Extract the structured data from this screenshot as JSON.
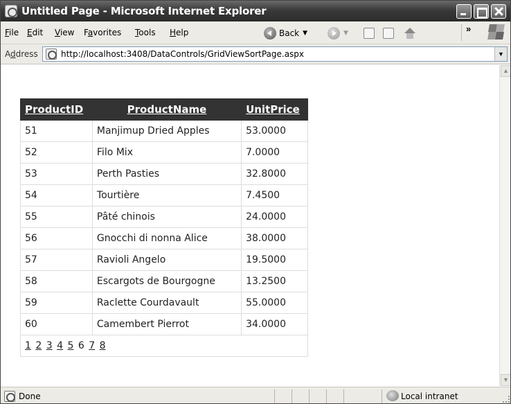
{
  "window": {
    "title": "Untitled Page - Microsoft Internet Explorer"
  },
  "menu": {
    "items": [
      {
        "label": "File",
        "accel": "F",
        "rest": "ile"
      },
      {
        "label": "Edit",
        "accel": "E",
        "rest": "dit"
      },
      {
        "label": "View",
        "accel": "V",
        "rest": "iew"
      },
      {
        "label": "Favorites",
        "pre": "F",
        "accel": "a",
        "rest": "vorites"
      },
      {
        "label": "Tools",
        "accel": "T",
        "rest": "ools"
      },
      {
        "label": "Help",
        "accel": "H",
        "rest": "elp"
      }
    ]
  },
  "toolbar": {
    "back_label": "Back",
    "overflow": "»"
  },
  "address": {
    "label_pre": "A",
    "label_accel": "d",
    "label_rest": "dress",
    "url": "http://localhost:3408/DataControls/GridViewSortPage.aspx"
  },
  "grid": {
    "headers": [
      "ProductID",
      "ProductName",
      "UnitPrice"
    ],
    "rows": [
      [
        "51",
        "Manjimup Dried Apples",
        "53.0000"
      ],
      [
        "52",
        "Filo Mix",
        "7.0000"
      ],
      [
        "53",
        "Perth Pasties",
        "32.8000"
      ],
      [
        "54",
        "Tourtière",
        "7.4500"
      ],
      [
        "55",
        "Pâté chinois",
        "24.0000"
      ],
      [
        "56",
        "Gnocchi di nonna Alice",
        "38.0000"
      ],
      [
        "57",
        "Ravioli Angelo",
        "19.5000"
      ],
      [
        "58",
        "Escargots de Bourgogne",
        "13.2500"
      ],
      [
        "59",
        "Raclette Courdavault",
        "55.0000"
      ],
      [
        "60",
        "Camembert Pierrot",
        "34.0000"
      ]
    ],
    "pager": {
      "pages": [
        "1",
        "2",
        "3",
        "4",
        "5",
        "6",
        "7",
        "8"
      ],
      "current": "6"
    }
  },
  "status": {
    "text": "Done",
    "zone": "Local intranet"
  },
  "colors": {
    "header_bg": "#333333",
    "titlebar": "#3a3a3a"
  }
}
